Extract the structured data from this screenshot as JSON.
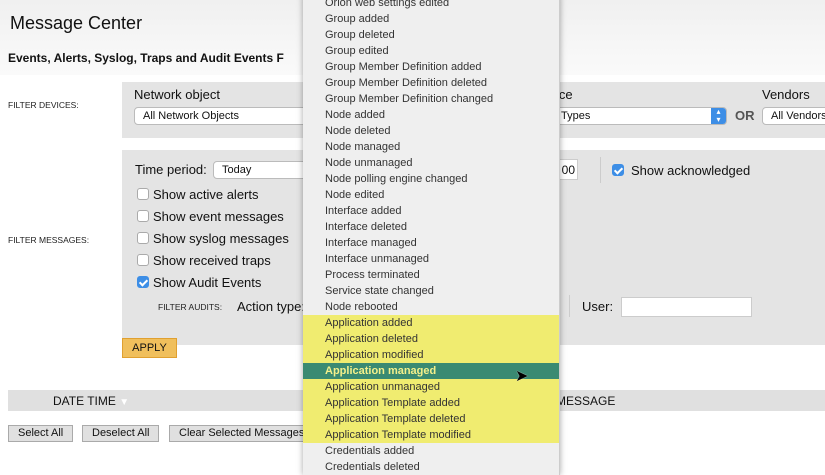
{
  "header": {
    "title": "Message Center",
    "subtitle": "Events, Alerts, Syslog, Traps and Audit Events F"
  },
  "filter_devices": {
    "label": "FILTER DEVICES:",
    "network_object_label": "Network object",
    "network_object_value": "All Network Objects",
    "device_type_label": "ice",
    "device_type_value": "Types",
    "or_label": "OR",
    "vendors_label": "Vendors",
    "vendors_value": "All Vendors"
  },
  "filter_messages": {
    "label": "FILTER MESSAGES:",
    "time_period_label": "Time period:",
    "time_period_value": "Today",
    "count_value": "00",
    "show_acknowledged": "Show acknowledged",
    "checkboxes": [
      {
        "label": "Show active alerts",
        "checked": false
      },
      {
        "label": "Show event messages",
        "checked": false
      },
      {
        "label": "Show syslog messages",
        "checked": false
      },
      {
        "label": "Show received traps",
        "checked": false
      },
      {
        "label": "Show Audit Events",
        "checked": true
      }
    ],
    "filter_audits_label": "FILTER AUDITS:",
    "action_type_label": "Action type:",
    "user_label": "User:",
    "user_value": ""
  },
  "apply_label": "APPLY",
  "table": {
    "col_datetime": "DATE TIME",
    "col_message": "MESSAGE"
  },
  "buttons": {
    "select_all": "Select All",
    "deselect_all": "Deselect All",
    "clear_selected": "Clear Selected Messages"
  },
  "dropdown": {
    "items": [
      "Orion web settings edited",
      "Group added",
      "Group deleted",
      "Group edited",
      "Group Member Definition added",
      "Group Member Definition deleted",
      "Group Member Definition changed",
      "Node added",
      "Node deleted",
      "Node managed",
      "Node unmanaged",
      "Node polling engine changed",
      "Node edited",
      "Interface added",
      "Interface deleted",
      "Interface managed",
      "Interface unmanaged",
      "Process terminated",
      "Service state changed",
      "Node rebooted",
      "Application added",
      "Application deleted",
      "Application modified",
      "Application managed",
      "Application unmanaged",
      "Application Template added",
      "Application Template deleted",
      "Application Template modified",
      "Credentials added",
      "Credentials deleted"
    ],
    "highlighted_range": [
      20,
      27
    ],
    "selected_index": 23,
    "highlight_color": "#f0ec70",
    "selected_color": "#3a8a72"
  }
}
